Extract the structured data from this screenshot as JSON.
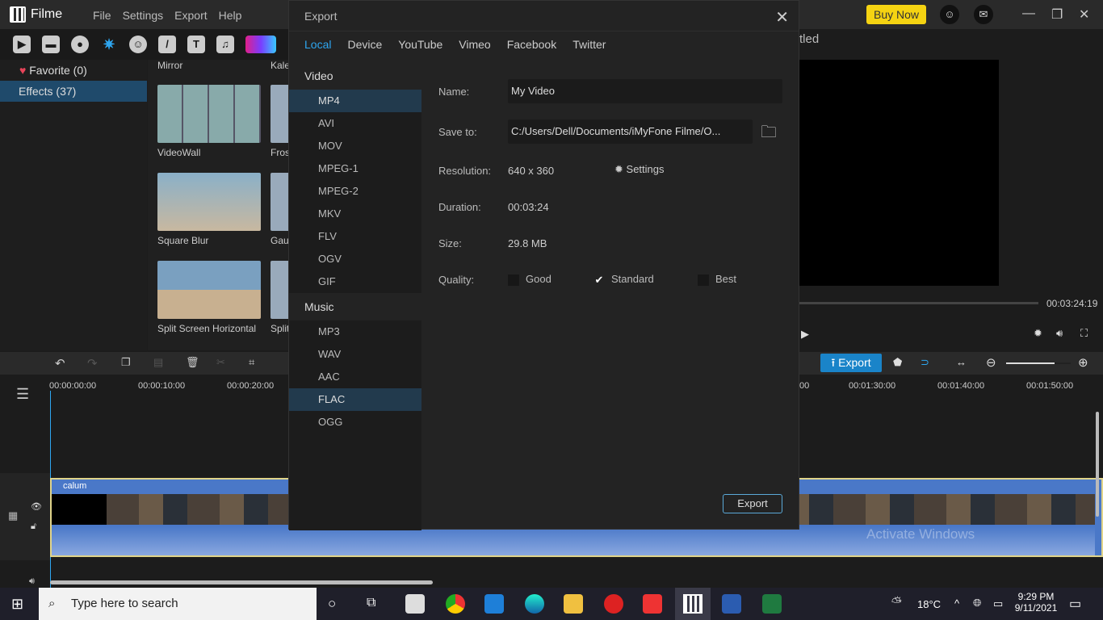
{
  "app": {
    "name": "Filme",
    "menu": [
      "File",
      "Settings",
      "Export",
      "Help"
    ],
    "buy_now": "Buy Now",
    "project_title_partial": "tled"
  },
  "sidebar": {
    "items": [
      {
        "label": "Favorite (0)",
        "icon": "heart-icon"
      },
      {
        "label": "Effects (37)",
        "active": true
      }
    ]
  },
  "effects": {
    "top_labels": [
      "Mirror",
      "Kale"
    ],
    "items": [
      "VideoWall",
      "Fros",
      "Square Blur",
      "Gau",
      "Split Screen Horizontal",
      "Split"
    ]
  },
  "dialog": {
    "title": "Export",
    "tabs": [
      "Local",
      "Device",
      "YouTube",
      "Vimeo",
      "Facebook",
      "Twitter"
    ],
    "active_tab": "Local",
    "video_header": "Video",
    "video_formats": [
      "MP4",
      "AVI",
      "MOV",
      "MPEG-1",
      "MPEG-2",
      "MKV",
      "FLV",
      "OGV",
      "GIF"
    ],
    "music_header": "Music",
    "music_formats": [
      "MP3",
      "WAV",
      "AAC",
      "FLAC",
      "OGG"
    ],
    "selected_format": "MP4",
    "hovered_format": "FLAC",
    "name_label": "Name:",
    "name_value": "My Video",
    "save_label": "Save to:",
    "save_value": "C:/Users/Dell/Documents/iMyFone Filme/O...",
    "resolution_label": "Resolution:",
    "resolution_value": "640 x 360",
    "settings_label": "Settings",
    "duration_label": "Duration:",
    "duration_value": "00:03:24",
    "size_label": "Size:",
    "size_value": "29.8 MB",
    "quality_label": "Quality:",
    "quality_options": [
      "Good",
      "Standard",
      "Best"
    ],
    "quality_selected": "Standard",
    "export_button": "Export"
  },
  "player": {
    "time": "00:03:24:19"
  },
  "timeline": {
    "export_label": "Export",
    "ticks": [
      "00:00:00:00",
      "00:00:10:00",
      "00:00:20:00",
      "00",
      "00:01:30:00",
      "00:01:40:00",
      "00:01:50:00"
    ],
    "clip_name": "calum",
    "zoom_level": 0.75
  },
  "watermark": "Activate Windows",
  "taskbar": {
    "search_placeholder": "Type here to search",
    "weather": "18°C",
    "time": "9:29 PM",
    "date": "9/11/2021"
  },
  "colors": {
    "accent": "#2ea6f0",
    "buy": "#f5d312",
    "clip": "#4a78c8"
  }
}
